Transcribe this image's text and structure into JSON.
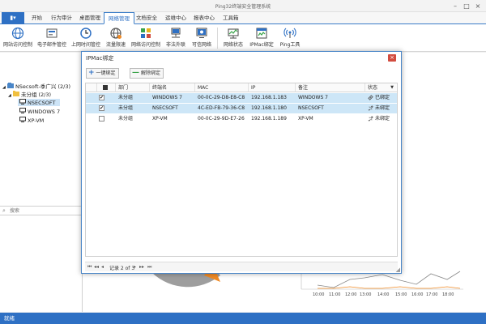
{
  "window": {
    "title": "Ping32终端安全管理系统"
  },
  "menu": {
    "app_label": "▮▾",
    "items": [
      "开始",
      "行为审计",
      "桌面管理",
      "网络管理",
      "文档安全",
      "运维中心",
      "报表中心",
      "工具箱"
    ],
    "active_index": 3
  },
  "toolbar": {
    "buttons": [
      {
        "label": "网站访问控制",
        "icon": "globe-icon"
      },
      {
        "label": "电子邮件管控",
        "icon": "mail-icon"
      },
      {
        "label": "上网时间管控",
        "icon": "clock-icon"
      },
      {
        "label": "流量限速",
        "icon": "speed-globe-icon"
      },
      {
        "label": "网络访问控制",
        "icon": "network-grid-icon"
      },
      {
        "label": "非法外联",
        "icon": "monitor-network-icon"
      },
      {
        "label": "可信网络",
        "icon": "trusted-network-icon"
      },
      {
        "label": "网络状态",
        "icon": "network-status-icon"
      },
      {
        "label": "IPMac绑定",
        "icon": "ipmac-icon"
      },
      {
        "label": "Ping工具",
        "icon": "ping-icon"
      }
    ]
  },
  "tree": {
    "root": {
      "label": "NSecsoft-季广兴 (2/3)"
    },
    "group": {
      "label": "未分组 (2/3)"
    },
    "items": [
      {
        "label": "NSECSOFT",
        "selected": true
      },
      {
        "label": "WINDOWS 7",
        "selected": false
      },
      {
        "label": "XP-VM",
        "selected": false
      }
    ],
    "search_placeholder": "搜索"
  },
  "dialog": {
    "title": "IPMac绑定",
    "close_label": "×",
    "bind_all_label": "一键绑定",
    "unbind_label": "解除绑定",
    "columns": [
      "部门",
      "终端名",
      "MAC",
      "IP",
      "备注",
      "状态"
    ],
    "rows": [
      {
        "checked": true,
        "dept": "未分组",
        "name": "WINDOWS 7",
        "mac": "00-0C-29-D8-E8-C8",
        "ip": "192.168.1.183",
        "note": "WINDOWS 7",
        "status": "已绑定",
        "bound": true,
        "selected": true
      },
      {
        "checked": true,
        "dept": "未分组",
        "name": "NSECSOFT",
        "mac": "4C-ED-FB-79-36-C8",
        "ip": "192.168.1.180",
        "note": "NSECSOFT",
        "status": "未绑定",
        "bound": false,
        "selected": true
      },
      {
        "checked": false,
        "dept": "未分组",
        "name": "XP-VM",
        "mac": "00-0C-29-9D-E7-26",
        "ip": "192.168.1.189",
        "note": "XP-VM",
        "status": "未绑定",
        "bound": false,
        "selected": false
      }
    ],
    "pager": {
      "text": "记录 2 of 3"
    }
  },
  "bg_chart": {
    "x_labels": [
      "10:00",
      "11:00",
      "12:00",
      "13:00",
      "14:00",
      "15:00",
      "16:00",
      "17:00",
      "18:00"
    ]
  },
  "statusbar": {
    "text": "就绪"
  },
  "colors": {
    "accent": "#2e70c4",
    "selection": "#cde6f7",
    "orange": "#f08a24"
  }
}
